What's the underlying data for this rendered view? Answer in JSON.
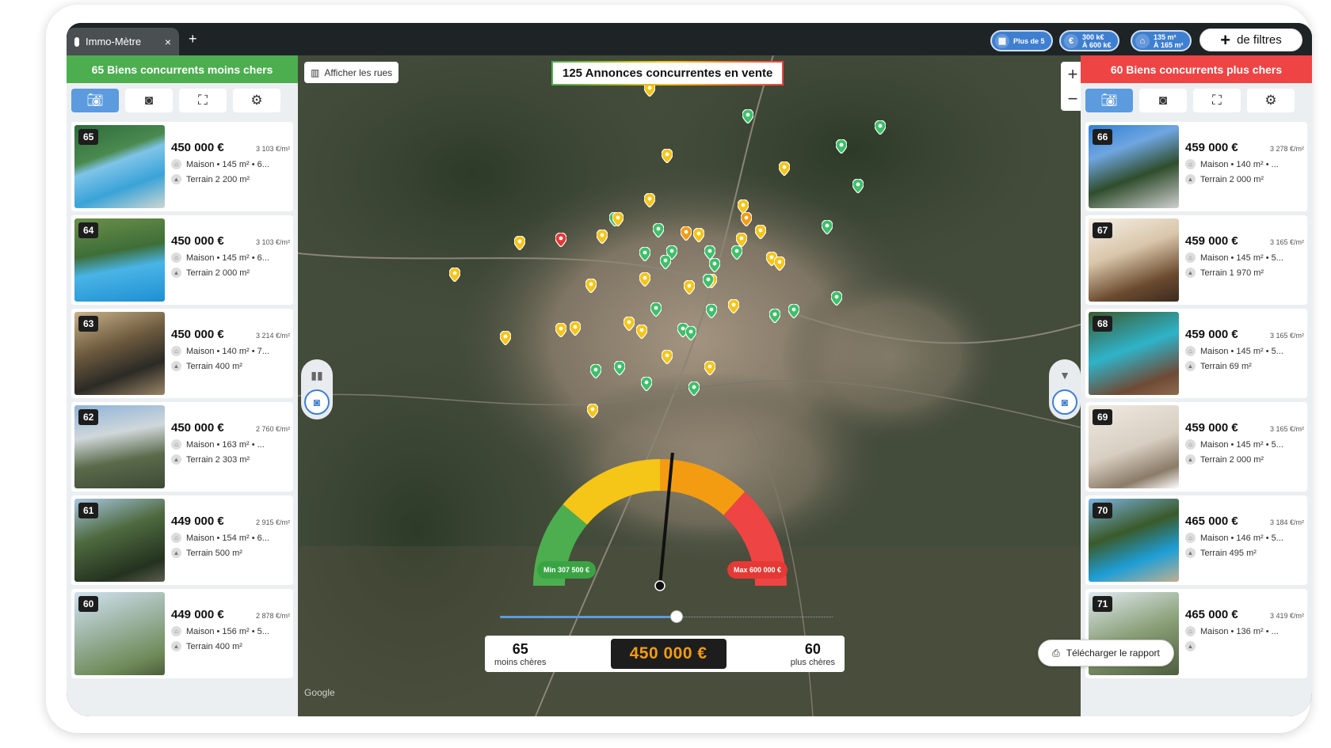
{
  "tab": {
    "title": "Immo-Mètre",
    "close": "×",
    "new_tab": "+"
  },
  "filters": {
    "chip1": "Plus de 5",
    "chip2_line1": "300 k€",
    "chip2_line2": "À 600 k€",
    "chip3_line1": "135 m²",
    "chip3_line2": "À 165 m²",
    "more_label": "de filtres",
    "more_icon": "+"
  },
  "left_panel": {
    "header": "65 Biens concurrents moins chers",
    "cards": [
      {
        "num": "65",
        "price": "450 000 €",
        "ppm": "3 103 €/m²",
        "detail": "Maison • 145 m² • 6...",
        "land": "Terrain 2 200 m²"
      },
      {
        "num": "64",
        "price": "450 000 €",
        "ppm": "3 103 €/m²",
        "detail": "Maison • 145 m² • 6...",
        "land": "Terrain 2 000 m²"
      },
      {
        "num": "63",
        "price": "450 000 €",
        "ppm": "3 214 €/m²",
        "detail": "Maison • 140 m² • 7...",
        "land": "Terrain 400 m²"
      },
      {
        "num": "62",
        "price": "450 000 €",
        "ppm": "2 760 €/m²",
        "detail": "Maison • 163 m² • ...",
        "land": "Terrain 2 303 m²"
      },
      {
        "num": "61",
        "price": "449 000 €",
        "ppm": "2 915 €/m²",
        "detail": "Maison • 154 m² • 6...",
        "land": "Terrain 500 m²"
      },
      {
        "num": "60",
        "price": "449 000 €",
        "ppm": "2 878 €/m²",
        "detail": "Maison • 156 m² • 5...",
        "land": "Terrain 400 m²"
      }
    ]
  },
  "right_panel": {
    "header": "60 Biens concurrents plus chers",
    "cards": [
      {
        "num": "66",
        "price": "459 000 €",
        "ppm": "3 278 €/m²",
        "detail": "Maison • 140 m² • ...",
        "land": "Terrain 2 000 m²"
      },
      {
        "num": "67",
        "price": "459 000 €",
        "ppm": "3 165 €/m²",
        "detail": "Maison • 145 m² • 5...",
        "land": "Terrain 1 970 m²"
      },
      {
        "num": "68",
        "price": "459 000 €",
        "ppm": "3 165 €/m²",
        "detail": "Maison • 145 m² • 5...",
        "land": "Terrain 69 m²"
      },
      {
        "num": "69",
        "price": "459 000 €",
        "ppm": "3 165 €/m²",
        "detail": "Maison • 145 m² • 5...",
        "land": "Terrain 2 000 m²"
      },
      {
        "num": "70",
        "price": "465 000 €",
        "ppm": "3 184 €/m²",
        "detail": "Maison • 146 m² • 5...",
        "land": "Terrain 495 m²"
      },
      {
        "num": "71",
        "price": "465 000 €",
        "ppm": "3 419 €/m²",
        "detail": "Maison • 136 m² • ...",
        "land": ""
      }
    ]
  },
  "map": {
    "streets_button": "Afficher les rues",
    "banner": "125 Annonces concurrentes en vente",
    "zoom_in": "+",
    "zoom_out": "−",
    "attribution": "Google"
  },
  "gauge": {
    "min_label": "Min 307 500 €",
    "max_label": "Max 600 000 €",
    "needle_fraction": 0.53,
    "colors": {
      "green": "#4cae4f",
      "yellow": "#f5c518",
      "orange": "#f39c12",
      "red": "#ef4444"
    }
  },
  "slider": {
    "fraction": 0.53
  },
  "result": {
    "less_count": "65",
    "less_label": "moins chères",
    "price": "450 000  €",
    "more_count": "60",
    "more_label": "plus chères"
  },
  "download_button": "Télécharger le rapport"
}
